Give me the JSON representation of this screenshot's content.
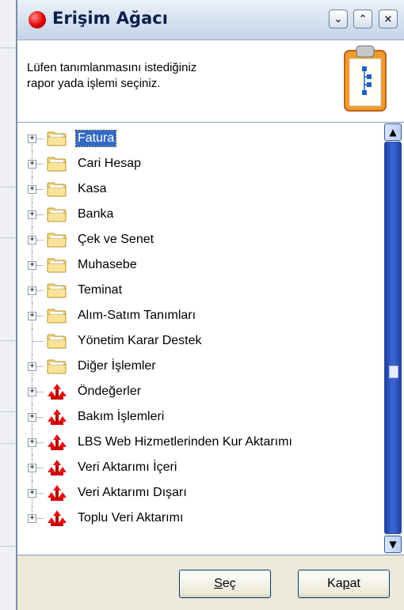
{
  "window": {
    "title": "Erişim Ağacı",
    "controls": {
      "minimize": "⌄",
      "maximize": "⌃",
      "close": "×"
    }
  },
  "info": {
    "line1": "Lüfen tanımlanmasını istediğiniz",
    "line2": "rapor yada işlemi seçiniz."
  },
  "tree": {
    "items": [
      {
        "label": "Fatura",
        "icon": "folder-icon",
        "expandable": true,
        "selected": true
      },
      {
        "label": "Cari Hesap",
        "icon": "folder-icon",
        "expandable": true
      },
      {
        "label": "Kasa",
        "icon": "folder-icon",
        "expandable": true
      },
      {
        "label": "Banka",
        "icon": "folder-icon",
        "expandable": true
      },
      {
        "label": "Çek ve Senet",
        "icon": "folder-icon",
        "expandable": true
      },
      {
        "label": "Muhasebe",
        "icon": "folder-icon",
        "expandable": true
      },
      {
        "label": "Teminat",
        "icon": "folder-icon",
        "expandable": true
      },
      {
        "label": "Alım-Satım Tanımları",
        "icon": "folder-icon",
        "expandable": true
      },
      {
        "label": "Yönetim Karar Destek",
        "icon": "folder-icon",
        "expandable": false
      },
      {
        "label": "Diğer İşlemler",
        "icon": "folder-icon",
        "expandable": true
      },
      {
        "label": "Öndeğerler",
        "icon": "tools-icon",
        "expandable": true
      },
      {
        "label": "Bakım İşlemleri",
        "icon": "tools-icon",
        "expandable": true
      },
      {
        "label": "LBS Web Hizmetlerinden Kur Aktarımı",
        "icon": "tools-icon",
        "expandable": true
      },
      {
        "label": "Veri Aktarımı İçeri",
        "icon": "tools-icon",
        "expandable": true
      },
      {
        "label": "Veri Aktarımı Dışarı",
        "icon": "tools-icon",
        "expandable": true
      },
      {
        "label": "Toplu Veri Aktarımı",
        "icon": "tools-icon",
        "expandable": true
      }
    ]
  },
  "buttons": {
    "select": {
      "pre": "",
      "accel": "S",
      "post": "eç"
    },
    "close": {
      "pre": "Ka",
      "accel": "p",
      "post": "at"
    }
  },
  "colors": {
    "selection": "#316ac5",
    "scroll_thumb": "#3563d0",
    "title_icon": "#e00000"
  }
}
